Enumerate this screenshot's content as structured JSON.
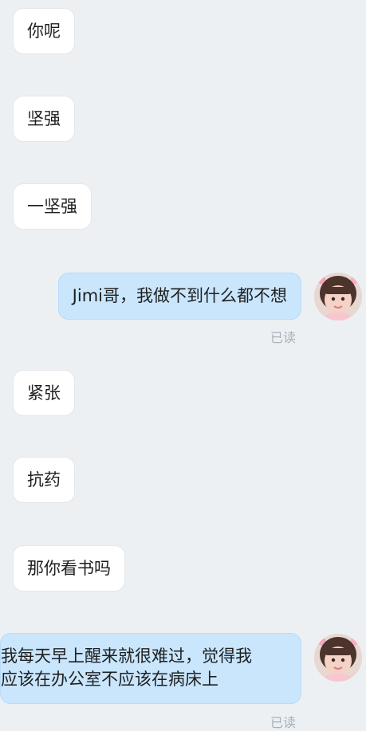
{
  "messages": [
    {
      "side": "in",
      "text": "你呢"
    },
    {
      "side": "in",
      "text": "坚强"
    },
    {
      "side": "in",
      "text": "一坚强"
    },
    {
      "side": "out",
      "text": "Jimi哥，我做不到什么都不想",
      "status": "已读"
    },
    {
      "side": "in",
      "text": "紧张"
    },
    {
      "side": "in",
      "text": "抗药"
    },
    {
      "side": "in",
      "text": "那你看书吗"
    },
    {
      "side": "out",
      "lines": [
        "我每天早上醒来就很难过，觉得我",
        "应该在办公室不应该在病床上"
      ],
      "status": "已读"
    }
  ],
  "avatar_icon": "user-avatar"
}
